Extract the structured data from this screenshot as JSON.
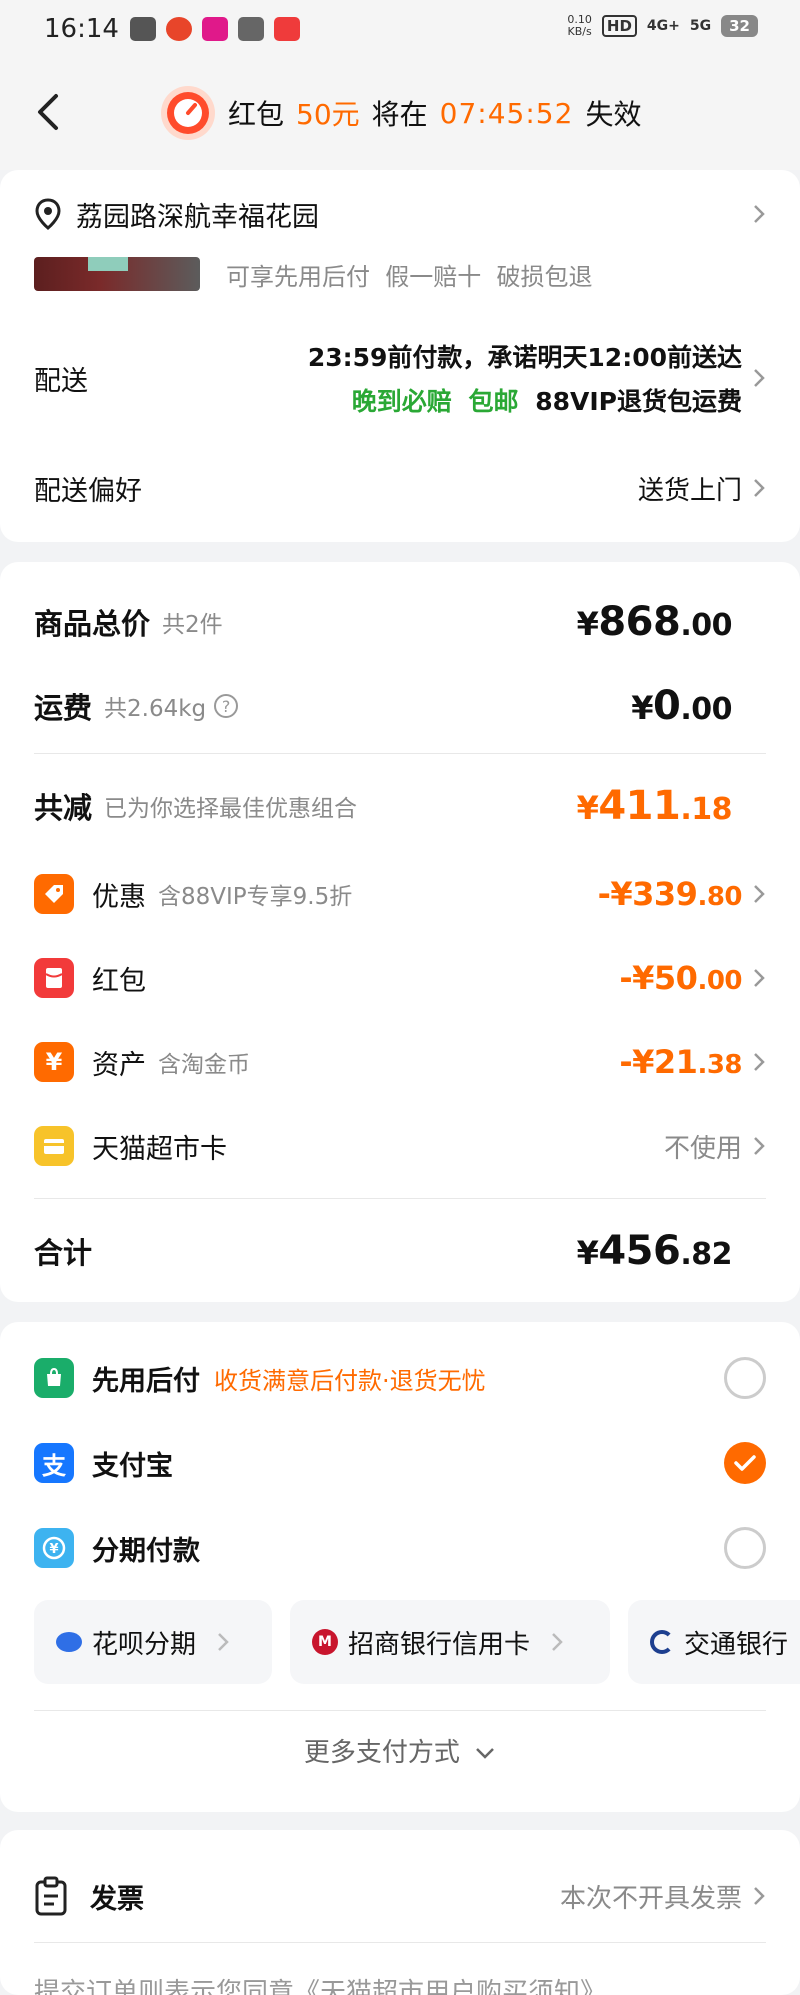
{
  "status_bar": {
    "time": "16:14",
    "net_speed_value": "0.10",
    "net_speed_unit": "KB/s",
    "hd": "HD",
    "net1": "4G+",
    "net2": "5G",
    "battery": "32"
  },
  "header": {
    "prefix": "红包",
    "amount": "50元",
    "middle": "将在",
    "countdown": "07:45:52",
    "suffix": "失效"
  },
  "address": {
    "text": "荔园路深航幸福花园"
  },
  "product_tags": "可享先用后付  假一赔十  破损包退",
  "delivery": {
    "label": "配送",
    "line1": "23:59前付款，承诺明天12:00前送达",
    "late_comp": "晚到必赔",
    "free_ship": "包邮",
    "vip_return": "88VIP退货包运费"
  },
  "delivery_pref": {
    "label": "配送偏好",
    "value": "送货上门"
  },
  "summary": {
    "goods_total": {
      "label": "商品总价",
      "sub": "共2件",
      "yen": "¥",
      "int": "868",
      "dec": ".00"
    },
    "shipping": {
      "label": "运费",
      "sub": "共2.64kg",
      "help": "?",
      "yen": "¥",
      "int": "0",
      "dec": ".00"
    },
    "reduction": {
      "label": "共减",
      "sub": "已为你选择最佳优惠组合",
      "yen": "¥",
      "int": "411",
      "dec": ".18"
    },
    "discounts": [
      {
        "label": "优惠",
        "sub": "含88VIP专享9.5折",
        "prefix": "-¥",
        "int": "339",
        "dec": ".80",
        "color": "#ff6a00"
      },
      {
        "label": "红包",
        "sub": "",
        "prefix": "-¥",
        "int": "50",
        "dec": ".00",
        "color": "#f23a3a"
      },
      {
        "label": "资产",
        "sub": "含淘金币",
        "prefix": "-¥",
        "int": "21",
        "dec": ".38",
        "color": "#ff6a00"
      },
      {
        "label": "天猫超市卡",
        "sub": "",
        "value": "不使用",
        "color": "#f7c32a"
      }
    ],
    "total": {
      "label": "合计",
      "yen": "¥",
      "int": "456",
      "dec": ".82"
    }
  },
  "payment": {
    "options": [
      {
        "label": "先用后付",
        "note": "收货满意后付款·退货无忧",
        "checked": false
      },
      {
        "label": "支付宝",
        "note": "",
        "checked": true
      },
      {
        "label": "分期付款",
        "note": "",
        "checked": false
      }
    ],
    "installments": [
      {
        "label": "花呗分期"
      },
      {
        "label": "招商银行信用卡"
      },
      {
        "label": "交通银行"
      }
    ],
    "more": "更多支付方式"
  },
  "invoice": {
    "label": "发票",
    "value": "本次不开具发票"
  },
  "agreement": "提交订单则表示您同意《天猫超市用户购买须知》"
}
